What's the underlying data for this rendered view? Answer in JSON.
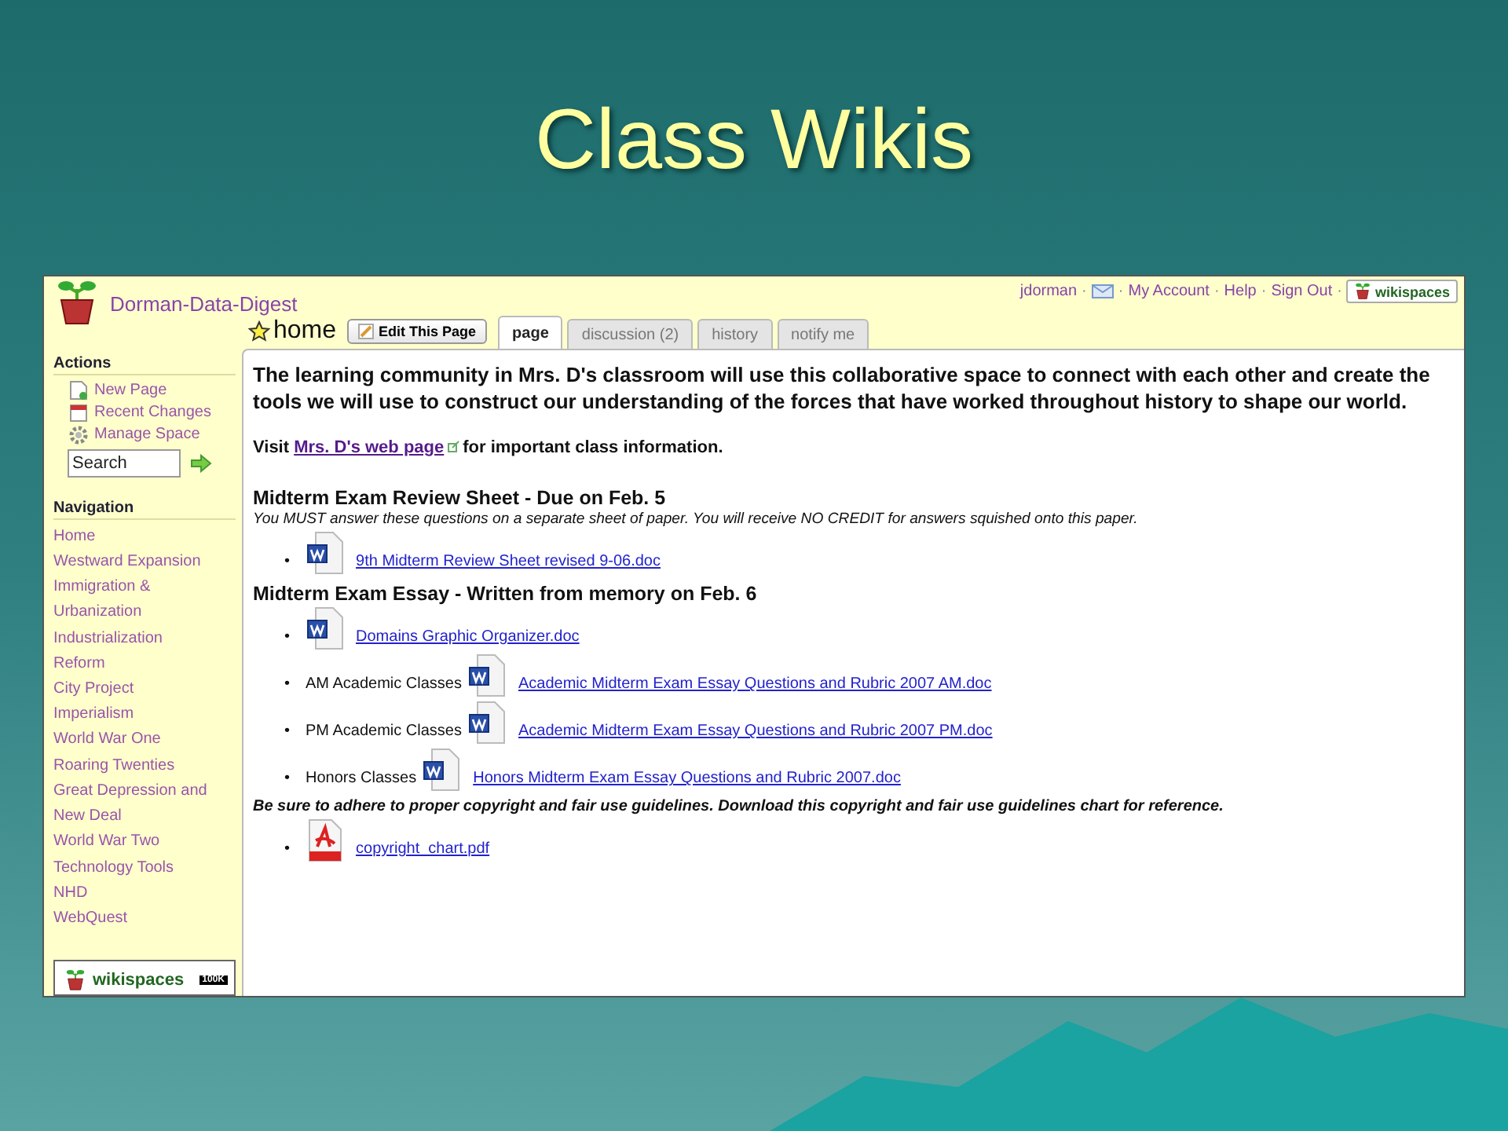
{
  "slide_title": "Class Wikis",
  "site": {
    "name": "Dorman-Data-Digest"
  },
  "user_bar": {
    "separator": "·",
    "username": "jdorman",
    "links": [
      "My Account",
      "Help",
      "Sign Out"
    ],
    "badge": "wikispaces"
  },
  "sidebar": {
    "actions_heading": "Actions",
    "actions": [
      {
        "kind": "new",
        "label": "New Page"
      },
      {
        "kind": "calendar",
        "label": "Recent Changes"
      },
      {
        "kind": "gear",
        "label": "Manage Space"
      }
    ],
    "search": {
      "placeholder": "Search"
    },
    "navigation_heading": "Navigation",
    "nav": [
      "Home",
      "Westward Expansion",
      "Immigration & Urbanization",
      "Industrialization",
      "Reform",
      "City Project",
      "Imperialism",
      "World War One",
      "Roaring Twenties",
      "Great Depression and New Deal",
      "World War Two",
      "Technology Tools",
      "NHD",
      "WebQuest"
    ],
    "badge": {
      "label": "wikispaces",
      "count": "100K"
    }
  },
  "page": {
    "title": "home",
    "edit_button": "Edit This Page",
    "tabs": [
      {
        "label": "page",
        "selected": true
      },
      {
        "label": "discussion (2)",
        "selected": false
      },
      {
        "label": "history",
        "selected": false
      },
      {
        "label": "notify me",
        "selected": false
      }
    ]
  },
  "content": [
    {
      "kind": "paragraph",
      "text": "The learning community in Mrs. D's classroom will use this collaborative space to connect with each other and create the tools we will use to construct our understanding of the forces that have worked throughout history to shape our world."
    },
    {
      "kind": "link_line",
      "before": "Visit",
      "link": "Mrs. D's web page",
      "after": "for important class information."
    },
    {
      "kind": "heading",
      "text": "Midterm Exam Review Sheet - Due on Feb. 5"
    },
    {
      "kind": "note",
      "text": "You MUST answer these questions on a separate sheet of paper. You will receive NO CREDIT for answers squished onto this paper."
    },
    {
      "kind": "files",
      "items": [
        {
          "kind": "word",
          "bullet": "•",
          "link": "9th Midterm Review Sheet revised 9-06.doc"
        }
      ]
    },
    {
      "kind": "heading",
      "text": "Midterm Exam Essay - Written from memory on Feb. 6"
    },
    {
      "kind": "files",
      "items": [
        {
          "kind": "word",
          "bullet": "•",
          "link": "Domains Graphic Organizer.doc"
        },
        {
          "kind": "word",
          "bullet": "•",
          "prefix": "AM Academic Classes",
          "link": "Academic Midterm Exam Essay Questions and Rubric 2007 AM.doc"
        },
        {
          "kind": "word",
          "bullet": "•",
          "prefix": "PM Academic Classes",
          "link": "Academic Midterm Exam Essay Questions and Rubric 2007 PM.doc"
        },
        {
          "kind": "word",
          "bullet": "•",
          "prefix": "Honors Classes",
          "link": "Honors Midterm Exam Essay Questions and Rubric 2007.doc"
        }
      ]
    },
    {
      "kind": "warning",
      "text": "Be sure to adhere to proper copyright and fair use guidelines. Download this copyright and fair use guidelines chart for reference."
    },
    {
      "kind": "files",
      "items": [
        {
          "kind": "pdf",
          "bullet": "•",
          "link": "copyright_chart.pdf"
        }
      ]
    }
  ]
}
